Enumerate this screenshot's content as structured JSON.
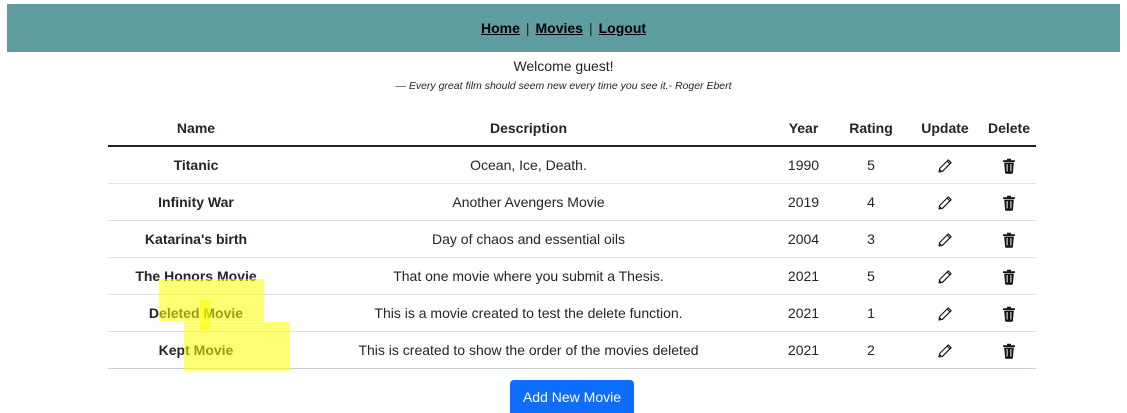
{
  "nav": {
    "home": "Home",
    "movies": "Movies",
    "logout": "Logout",
    "separator": "|"
  },
  "welcome": "Welcome guest!",
  "quote": "— Every great film should seem new every time you see it.- Roger Ebert",
  "table": {
    "headers": {
      "name": "Name",
      "description": "Description",
      "year": "Year",
      "rating": "Rating",
      "update": "Update",
      "delete": "Delete"
    },
    "rows": [
      {
        "name": "Titanic",
        "description": "Ocean, Ice, Death.",
        "year": "1990",
        "rating": "5"
      },
      {
        "name": "Infinity War",
        "description": "Another Avengers Movie",
        "year": "2019",
        "rating": "4"
      },
      {
        "name": "Katarina's birth",
        "description": "Day of chaos and essential oils",
        "year": "2004",
        "rating": "3"
      },
      {
        "name": "The Honors Movie",
        "description": "That one movie where you submit a Thesis.",
        "year": "2021",
        "rating": "5"
      },
      {
        "name": "Deleted Movie",
        "description": "This is a movie created to test the delete function.",
        "year": "2021",
        "rating": "1"
      },
      {
        "name": "Kept Movie",
        "description": "This is created to show the order of the movies deleted",
        "year": "2021",
        "rating": "2"
      }
    ]
  },
  "icons": {
    "update": "pencil-icon",
    "delete": "trash-icon"
  },
  "add_button": "Add New Movie",
  "colors": {
    "navbar": "#5f9ea0",
    "primary_button": "#0d6efd",
    "highlight": "#ffff00"
  }
}
